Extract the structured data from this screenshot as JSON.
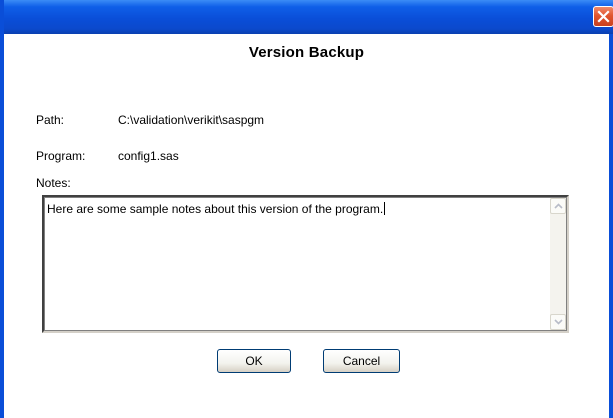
{
  "window": {
    "title": "",
    "accent": "#0a4ed8",
    "close_icon": "close-icon"
  },
  "dialog": {
    "title": "Version Backup",
    "path_label": "Path:",
    "path_value": "C:\\validation\\verikit\\saspgm",
    "program_label": "Program:",
    "program_value": "config1.sas",
    "notes_label": "Notes:",
    "notes_value": "Here are some sample notes about this version of the program."
  },
  "buttons": {
    "ok_label": "OK",
    "cancel_label": "Cancel"
  }
}
